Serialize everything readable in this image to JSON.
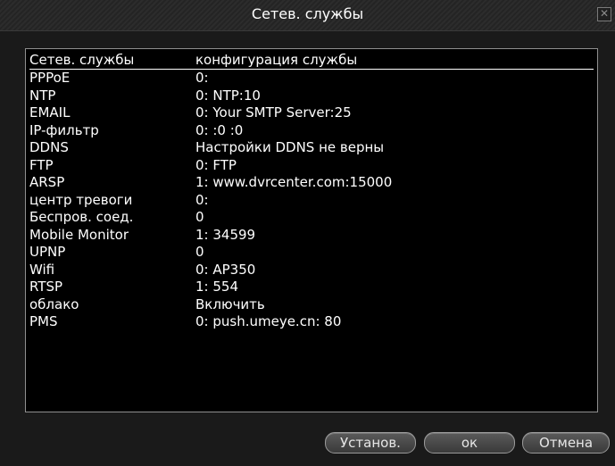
{
  "window": {
    "title": "Сетев. службы",
    "close_glyph": "✕"
  },
  "table": {
    "header": {
      "service": "Сетев. службы",
      "config": "конфигурация службы"
    },
    "rows": [
      {
        "service": "PPPoE",
        "config": "0:"
      },
      {
        "service": "NTP",
        "config": "0: NTP:10"
      },
      {
        "service": "EMAIL",
        "config": "0: Your SMTP Server:25"
      },
      {
        "service": "IP-фильтр",
        "config": "0: :0 :0"
      },
      {
        "service": " DDNS",
        "config": "Настройки DDNS не верны"
      },
      {
        "service": "FTP",
        "config": "0: FTP"
      },
      {
        "service": "ARSP",
        "config": "1: www.dvrcenter.com:15000"
      },
      {
        "service": "центр тревоги",
        "config": "0:"
      },
      {
        "service": "Беспров. соед.",
        "config": "0"
      },
      {
        "service": "Mobile Monitor",
        "config": "1: 34599"
      },
      {
        "service": "UPNP",
        "config": "0"
      },
      {
        "service": "Wifi",
        "config": "0: AP350"
      },
      {
        "service": "RTSP",
        "config": "1: 554"
      },
      {
        "service": "облако",
        "config": "Включить"
      },
      {
        "service": "PMS",
        "config": "0: push.umeye.cn: 80"
      }
    ]
  },
  "buttons": {
    "apply": "Установ.",
    "ok": "ок",
    "cancel": "Отмена"
  }
}
